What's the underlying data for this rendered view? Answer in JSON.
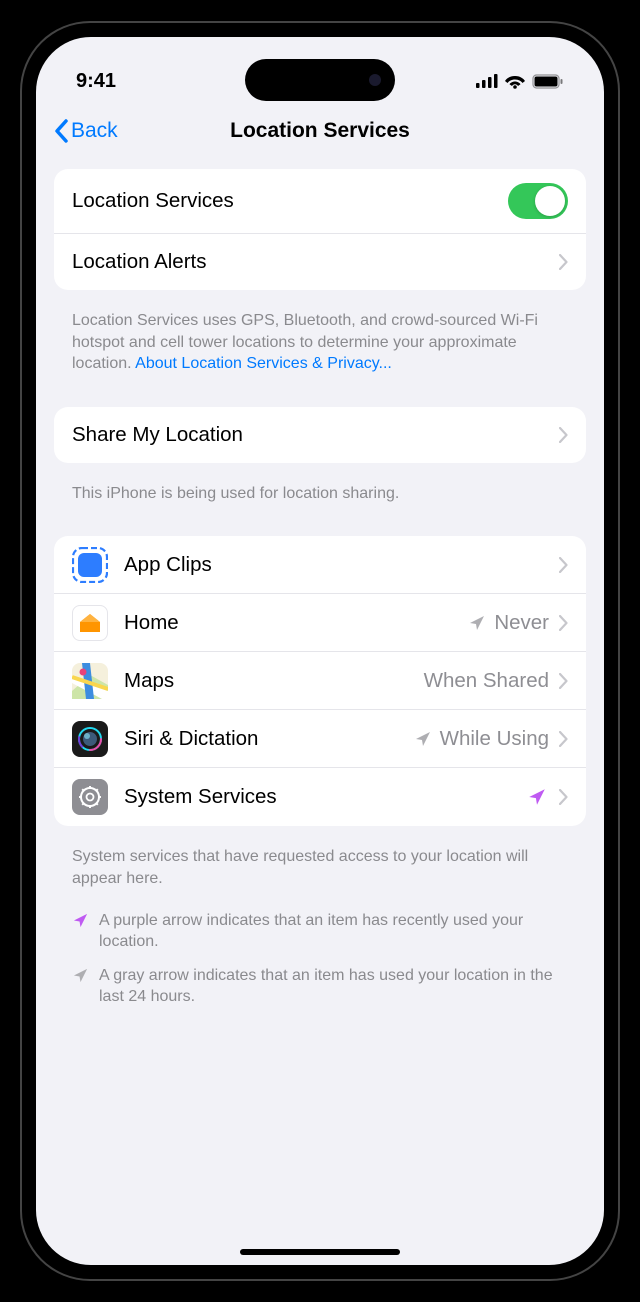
{
  "status": {
    "time": "9:41"
  },
  "nav": {
    "back": "Back",
    "title": "Location Services"
  },
  "main": {
    "locationServices": "Location Services",
    "locationAlerts": "Location Alerts",
    "footer1_pre": "Location Services uses GPS, Bluetooth, and crowd-sourced Wi-Fi hotspot and cell tower locations to determine your approximate location. ",
    "footer1_link": "About Location Services & Privacy...",
    "shareLocation": "Share My Location",
    "footer2": "This iPhone is being used for location sharing.",
    "apps": [
      {
        "label": "App Clips",
        "value": "",
        "arrow": "none"
      },
      {
        "label": "Home",
        "value": "Never",
        "arrow": "gray"
      },
      {
        "label": "Maps",
        "value": "When Shared",
        "arrow": "none"
      },
      {
        "label": "Siri & Dictation",
        "value": "While Using",
        "arrow": "gray"
      },
      {
        "label": "System Services",
        "value": "",
        "arrow": "purple"
      }
    ],
    "footer3": "System services that have requested access to your location will appear here.",
    "legendPurple": "A purple arrow indicates that an item has recently used your location.",
    "legendGray": "A gray arrow indicates that an item has used your location in the last 24 hours."
  }
}
